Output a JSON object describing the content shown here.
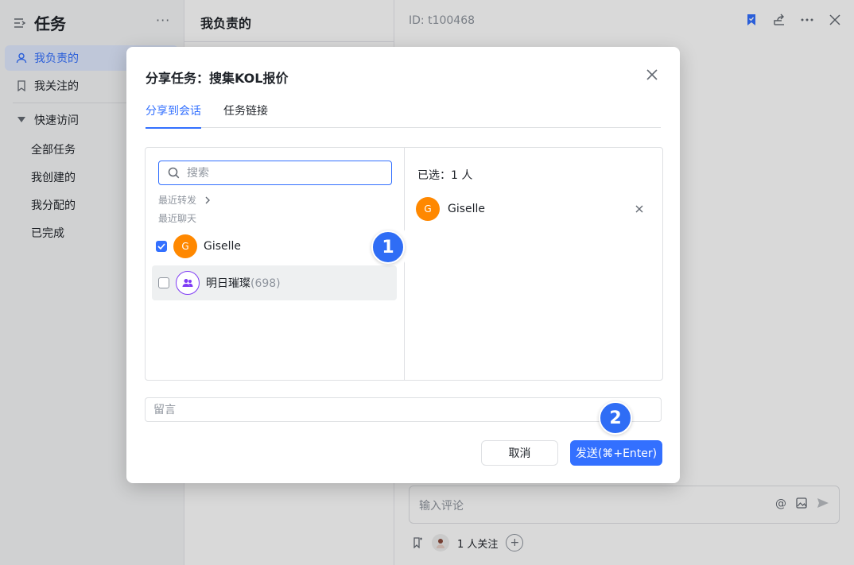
{
  "sidebar": {
    "title": "任务",
    "more": "···",
    "items": [
      {
        "label": "我负责的",
        "icon": "user-icon"
      },
      {
        "label": "我关注的",
        "icon": "bookmark-icon"
      }
    ],
    "section": {
      "label": "快速访问",
      "icon": "caret-down-icon"
    },
    "sub_items": [
      "全部任务",
      "我创建的",
      "我分配的",
      "已完成"
    ]
  },
  "list_panel": {
    "title": "我负责的"
  },
  "detail": {
    "id_text": "ID: t100468",
    "comment_placeholder": "输入评论",
    "follow_text": "1 人关注"
  },
  "modal": {
    "title": "分享任务：搜集KOL报价",
    "tabs": [
      {
        "label": "分享到会话",
        "active": true
      },
      {
        "label": "任务链接",
        "active": false
      }
    ],
    "search_placeholder": "搜索",
    "recent_forward_label": "最近转发",
    "recent_chat_label": "最近聊天",
    "contacts": [
      {
        "name": "Giselle",
        "initial": "G",
        "checked": true,
        "avatar_color": "#ff8800"
      },
      {
        "name": "明日璀璨",
        "count": "(698)",
        "checked": false,
        "type": "group",
        "avatar_color": "#7f3bf5"
      }
    ],
    "selected_label": "已选：1 人",
    "selected": [
      {
        "name": "Giselle",
        "initial": "G"
      }
    ],
    "message_placeholder": "留言",
    "cancel_label": "取消",
    "send_label": "发送(⌘+Enter)"
  },
  "steps": [
    "1",
    "2"
  ],
  "colors": {
    "accent": "#3370ff",
    "step": "#2f6df5",
    "avatar_orange": "#ff8800",
    "group_purple": "#7f3bf5"
  }
}
